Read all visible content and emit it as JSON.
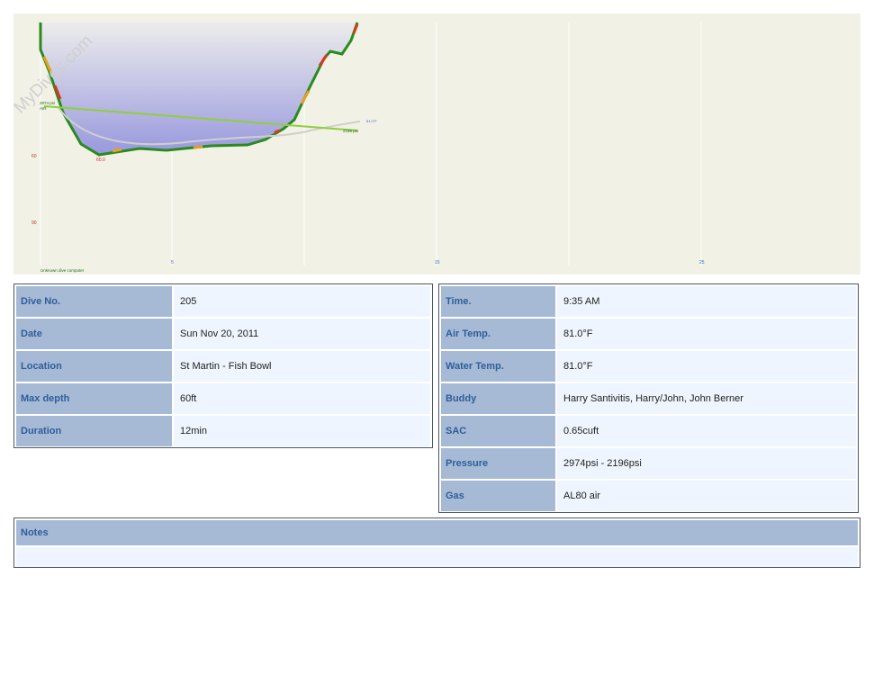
{
  "watermark": "MyDives.com",
  "profile": {
    "depth_ticks": [
      "60",
      "90"
    ],
    "time_ticks": [
      "5",
      "15",
      "25"
    ],
    "start_pressure_label": "2974 psi",
    "gas_label": "AIR",
    "end_pressure_label": "2196 psi",
    "max_depth_label": "60.0",
    "temp_label": "81.0°F",
    "computer_label": "Unknown dive computer"
  },
  "dive_info": {
    "rows": [
      {
        "label": "Dive No.",
        "value": "205"
      },
      {
        "label": "Date",
        "value": "Sun Nov 20, 2011"
      },
      {
        "label": "Location",
        "value": "St Martin - Fish Bowl"
      },
      {
        "label": "Max depth",
        "value": "60ft"
      },
      {
        "label": "Duration",
        "value": "12min"
      }
    ]
  },
  "dive_details": {
    "rows": [
      {
        "label": "Time.",
        "value": "9:35 AM"
      },
      {
        "label": "Air Temp.",
        "value": "81.0°F"
      },
      {
        "label": "Water Temp.",
        "value": "81.0°F"
      },
      {
        "label": "Buddy",
        "value": "Harry Santivitis, Harry/John, John Berner"
      },
      {
        "label": "SAC",
        "value": "0.65cuft"
      },
      {
        "label": "Pressure",
        "value": "2974psi - 2196psi"
      },
      {
        "label": "Gas",
        "value": "AL80 air"
      }
    ]
  },
  "notes": {
    "label": "Notes",
    "text": ""
  },
  "colors": {
    "label_bg": "#a6bad6",
    "label_text": "#2e5e9a",
    "value_bg": "#eef5ff",
    "chart_bg": "#f2f1e6",
    "profile_fill_top": "#eeeeee",
    "profile_fill_bottom": "#9a9ae0",
    "pressure_line": "#8fcf3a"
  }
}
